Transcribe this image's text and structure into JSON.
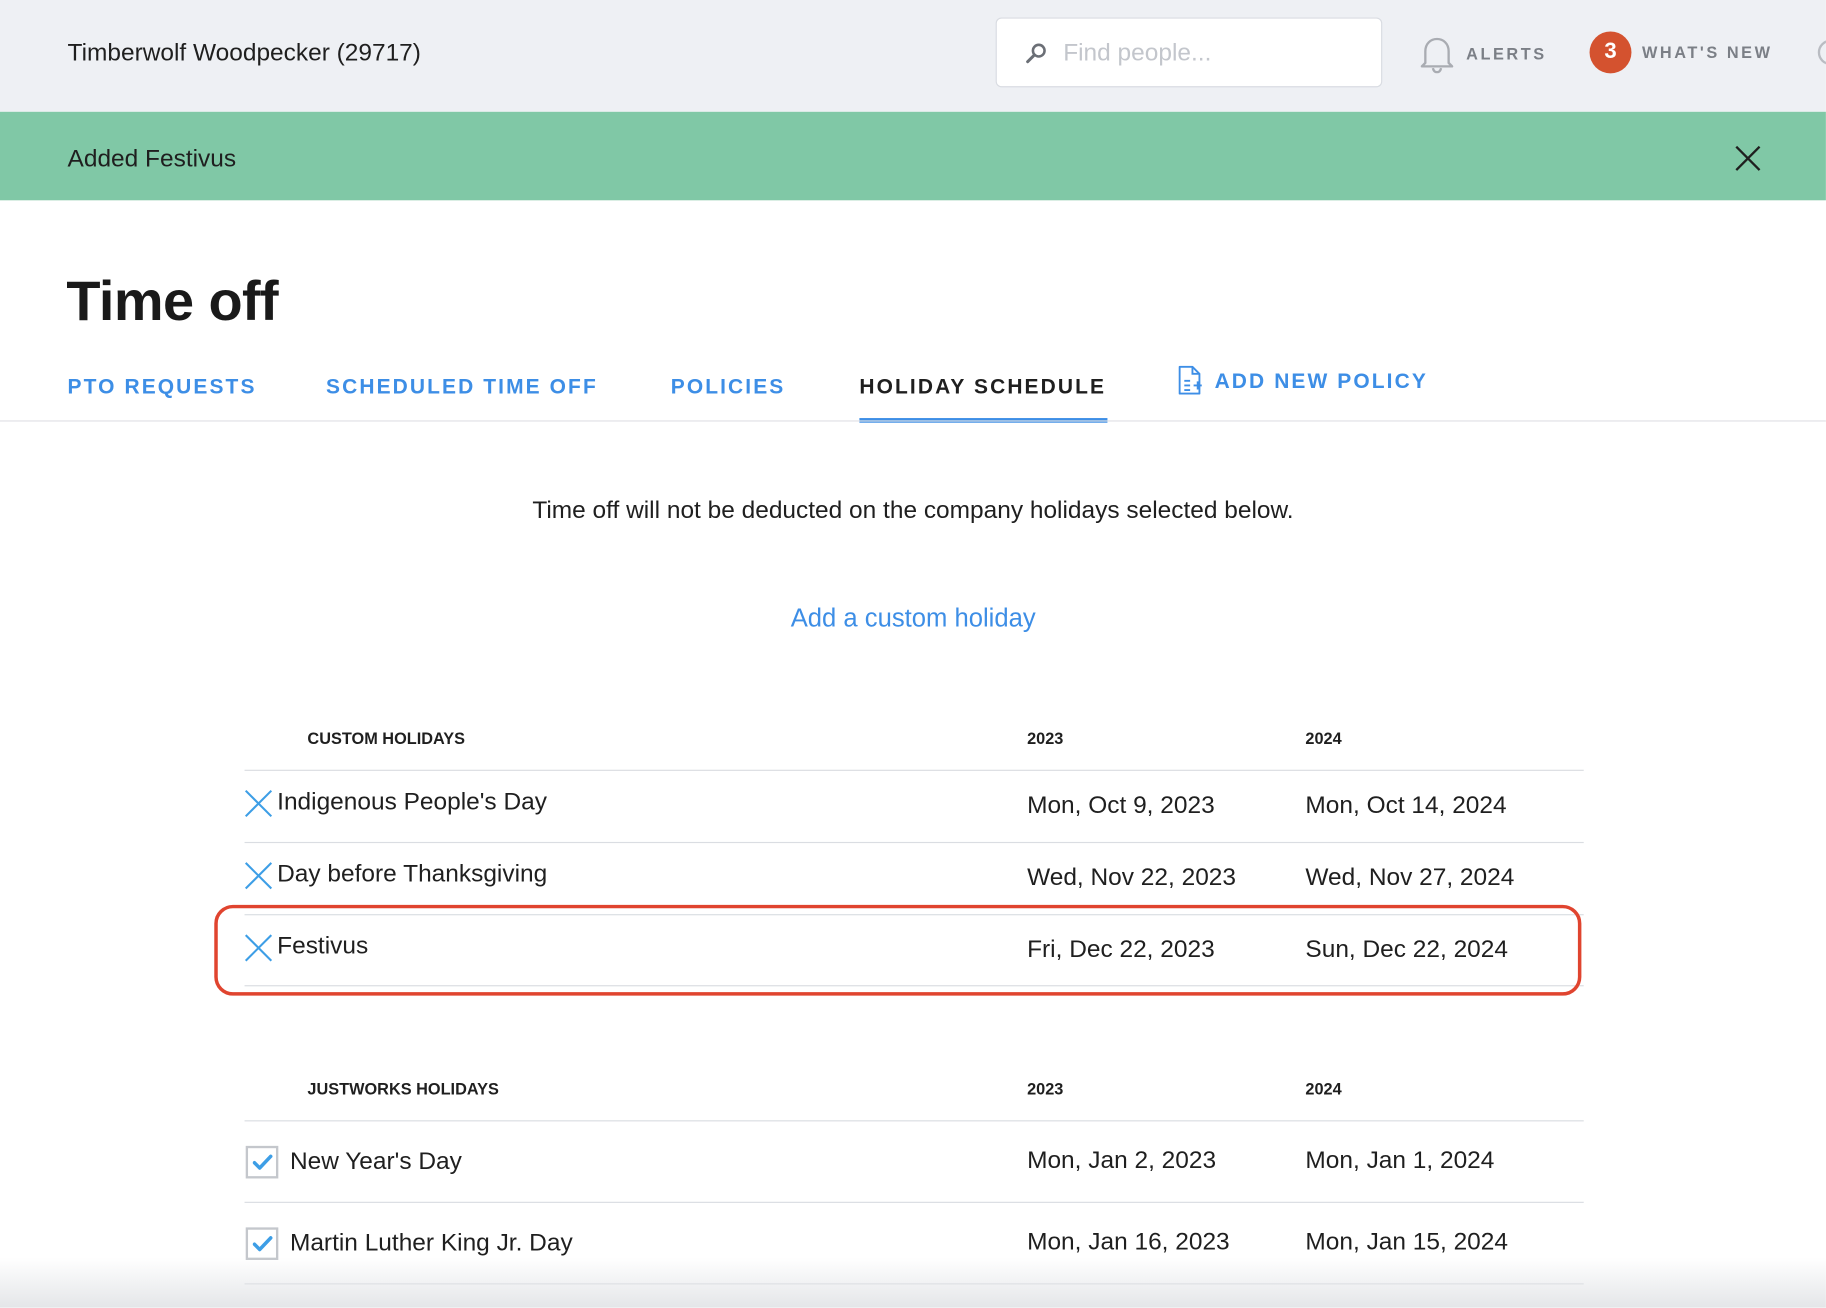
{
  "header": {
    "company_name": "Timberwolf Woodpecker (29717)",
    "search_placeholder": "Find people...",
    "alerts_label": "ALERTS",
    "whats_new_count": "3",
    "whats_new_label": "WHAT'S NEW"
  },
  "banner": {
    "message": "Added Festivus"
  },
  "page": {
    "title": "Time off",
    "tabs": [
      {
        "label": "PTO REQUESTS",
        "active": false
      },
      {
        "label": "SCHEDULED TIME OFF",
        "active": false
      },
      {
        "label": "POLICIES",
        "active": false
      },
      {
        "label": "HOLIDAY SCHEDULE",
        "active": true
      }
    ],
    "add_policy_label": "ADD NEW POLICY",
    "intro_text": "Time off will not be deducted on the company holidays selected below.",
    "add_custom_label": "Add a custom holiday"
  },
  "custom_holidays": {
    "header": {
      "name": "CUSTOM HOLIDAYS",
      "year1": "2023",
      "year2": "2024"
    },
    "rows": [
      {
        "name": "Indigenous People's Day",
        "date1": "Mon, Oct 9, 2023",
        "date2": "Mon, Oct 14, 2024"
      },
      {
        "name": "Day before Thanksgiving",
        "date1": "Wed, Nov 22, 2023",
        "date2": "Wed, Nov 27, 2024"
      },
      {
        "name": "Festivus",
        "date1": "Fri, Dec 22, 2023",
        "date2": "Sun, Dec 22, 2024"
      }
    ]
  },
  "justworks_holidays": {
    "header": {
      "name": "JUSTWORKS HOLIDAYS",
      "year1": "2023",
      "year2": "2024"
    },
    "rows": [
      {
        "name": "New Year's Day",
        "date1": "Mon, Jan 2, 2023",
        "date2": "Mon, Jan 1, 2024",
        "checked": true
      },
      {
        "name": "Martin Luther King Jr. Day",
        "date1": "Mon, Jan 16, 2023",
        "date2": "Mon, Jan 15, 2024",
        "checked": true
      }
    ]
  },
  "colors": {
    "accent_blue": "#3d8ee6",
    "banner_green": "#80c8a6",
    "badge_orange": "#d4522f",
    "highlight_red": "#e0442f"
  }
}
